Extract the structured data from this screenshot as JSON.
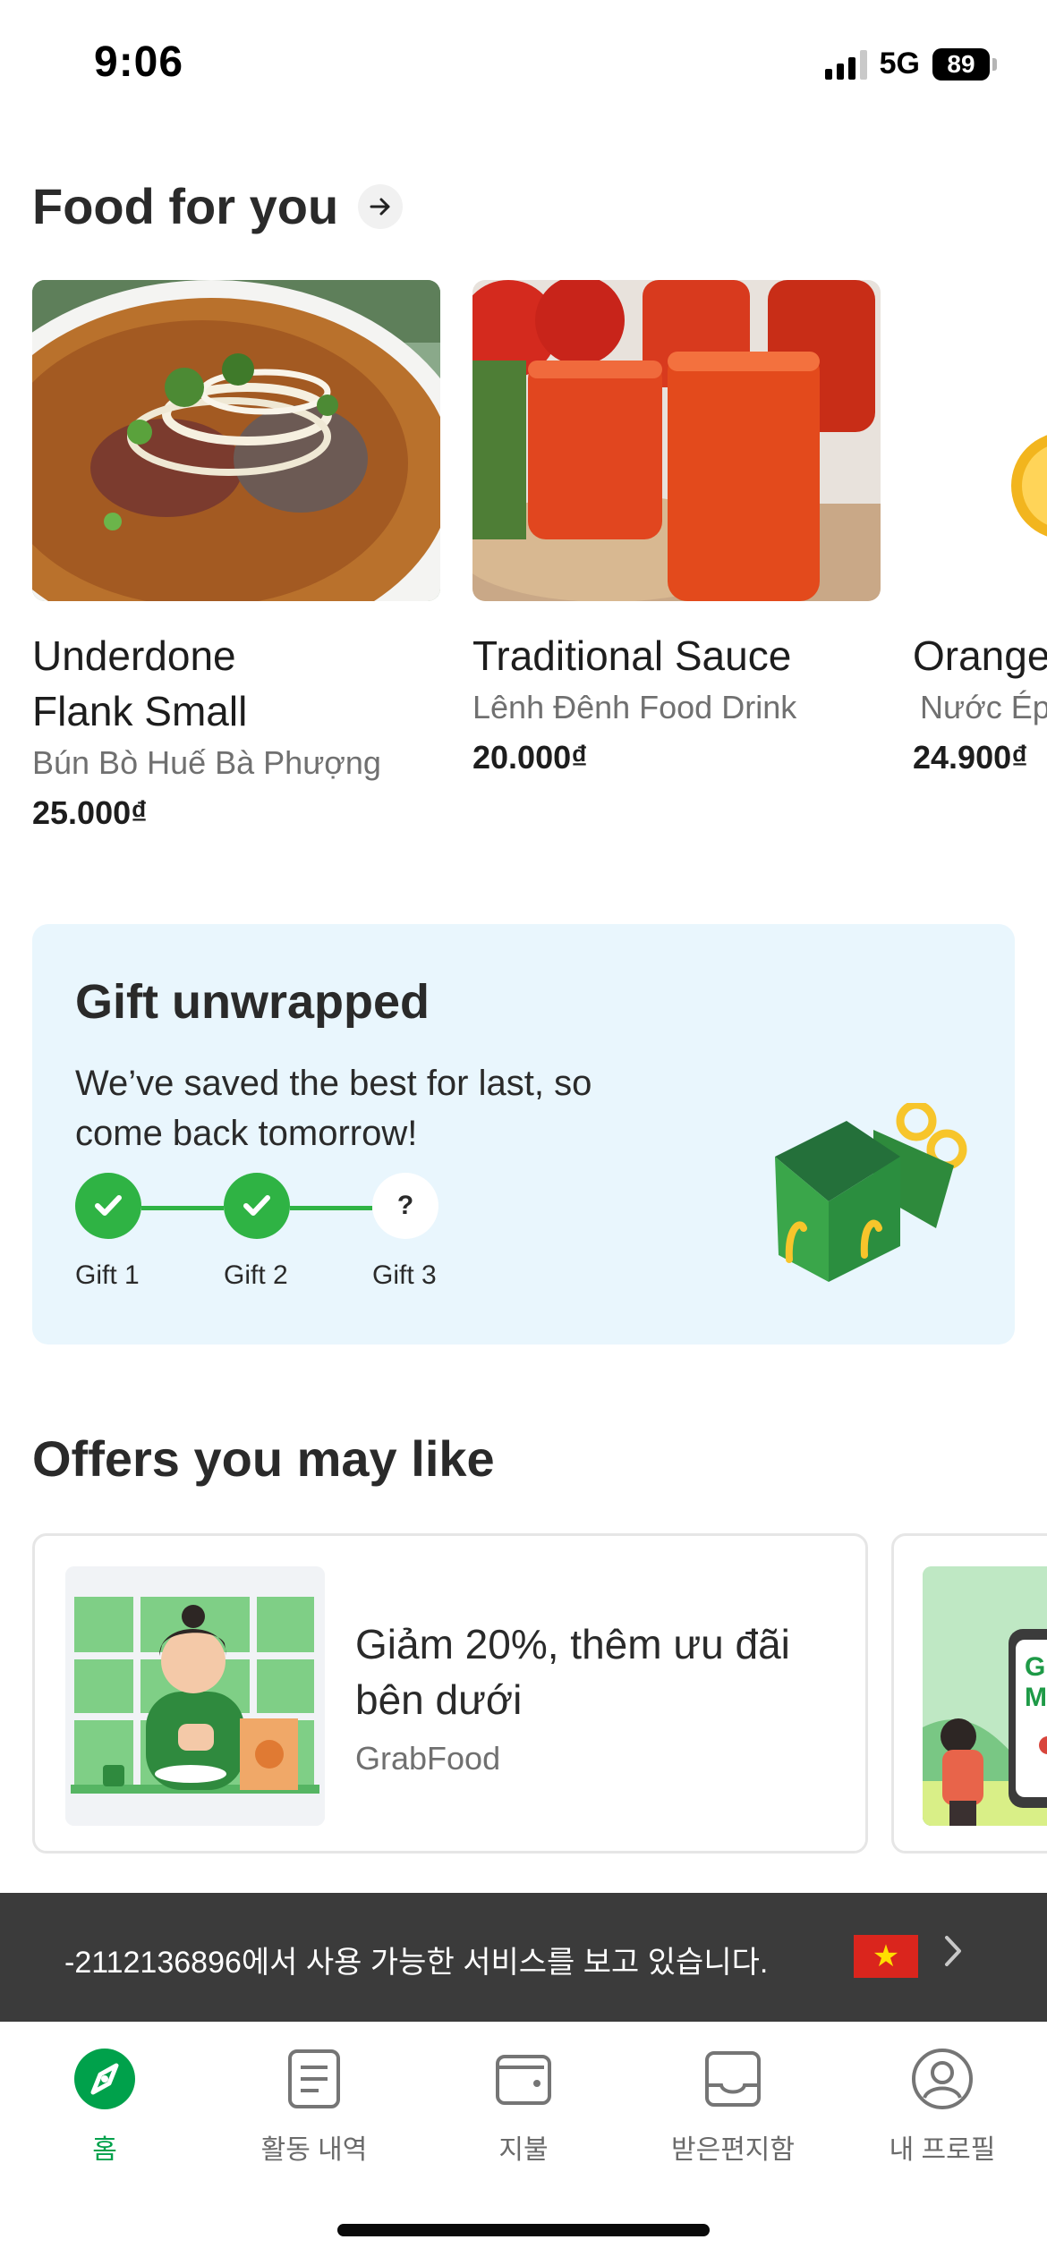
{
  "status_bar": {
    "time": "9:06",
    "network": "5G",
    "battery": "89"
  },
  "food_section": {
    "title": "Food for you",
    "items": [
      {
        "name_line1": "Underdone",
        "name_line2": "Flank Small",
        "shop": "Bún Bò Huế Bà Phượng",
        "price": "25.000₫"
      },
      {
        "name_line1": "Traditional Sauce",
        "name_line2": "",
        "shop": "Lênh Đênh Food Drink",
        "price": "20.000₫"
      },
      {
        "name_line1": "Orange",
        "name_line2": "",
        "shop": "Nước Ép",
        "price": "24.900₫"
      }
    ]
  },
  "gift": {
    "title": "Gift unwrapped",
    "subtitle": "We’ve saved the best for last, so come back tomorrow!",
    "steps": [
      {
        "label": "Gift 1",
        "status": "done"
      },
      {
        "label": "Gift 2",
        "status": "done"
      },
      {
        "label": "Gift 3",
        "status": "locked",
        "mark": "?"
      }
    ]
  },
  "offers_section": {
    "title": "Offers you may like",
    "items": [
      {
        "title": "Giảm 20%, thêm ưu đãi bên dưới",
        "brand": "GrabFood",
        "image_text": ""
      },
      {
        "title": "",
        "brand": "",
        "image_text": "Gr Mo"
      }
    ]
  },
  "location_banner": {
    "text": "-2112136896에서 사용 가능한 서비스를 보고 있습니다.",
    "flag_icon": "vietnam-flag-icon"
  },
  "tabbar": {
    "items": [
      {
        "label": "홈",
        "icon": "compass-icon",
        "active": true
      },
      {
        "label": "활동 내역",
        "icon": "activity-list-icon",
        "active": false
      },
      {
        "label": "지불",
        "icon": "wallet-icon",
        "active": false
      },
      {
        "label": "받은편지함",
        "icon": "inbox-icon",
        "active": false
      },
      {
        "label": "내 프로필",
        "icon": "profile-icon",
        "active": false
      }
    ]
  },
  "colors": {
    "brand_green": "#00a14b",
    "step_green": "#2fb344",
    "gift_bg": "#e9f6fd",
    "banner_bg": "#3b3b3b"
  }
}
